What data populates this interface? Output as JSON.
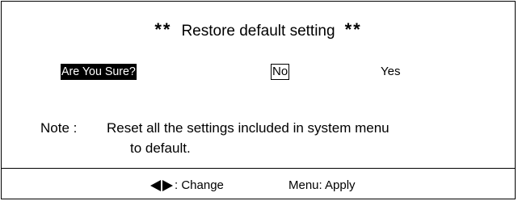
{
  "dialog": {
    "title_prefix": "**",
    "title": "Restore default setting",
    "title_suffix": "**",
    "prompt": "Are You Sure?",
    "options": {
      "no": "No",
      "yes": "Yes"
    },
    "selected_option": "No",
    "note_label": "Note :",
    "note_line1": "Reset all the settings included in system menu",
    "note_line2": "to default."
  },
  "footer": {
    "change_icon": "left-right-arrows-icon",
    "change_label": ": Change",
    "apply_label": "Menu: Apply"
  },
  "colors": {
    "background": "#ffffff",
    "foreground": "#000000",
    "highlight_bg": "#000000",
    "highlight_fg": "#ffffff"
  }
}
